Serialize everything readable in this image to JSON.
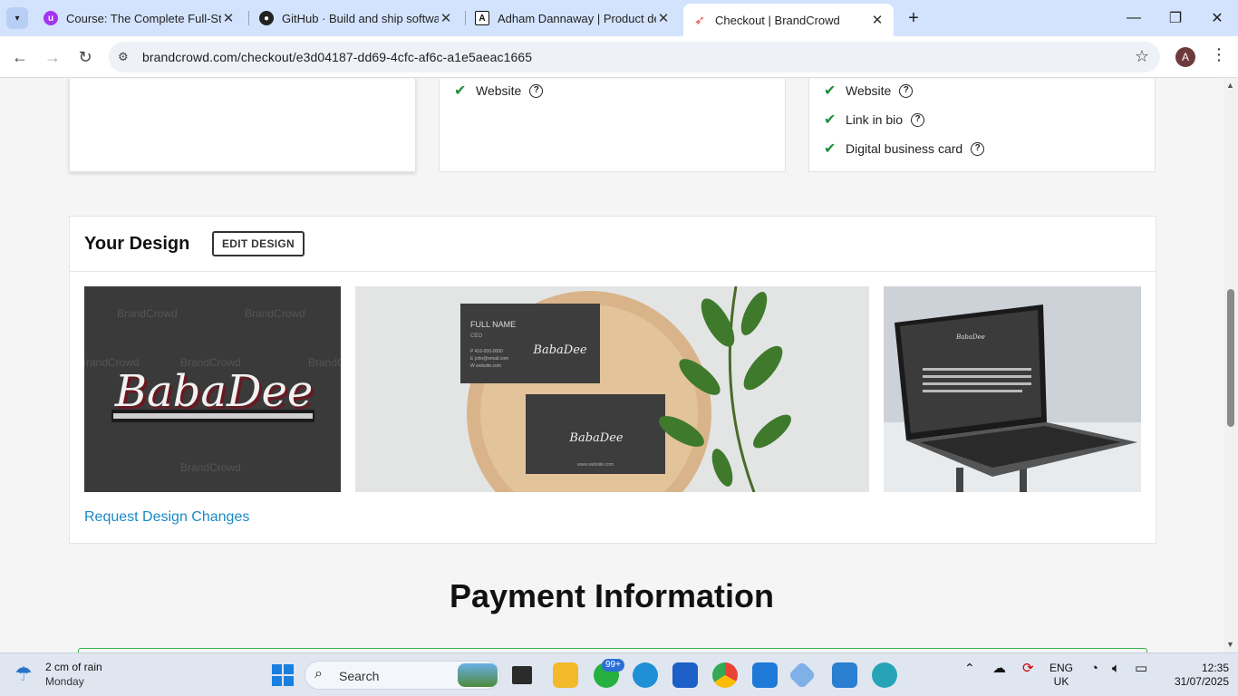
{
  "browser": {
    "tabs": [
      {
        "title": "Course: The Complete Full-Stack",
        "active": false
      },
      {
        "title": "GitHub · Build and ship software",
        "active": false
      },
      {
        "title": "Adham Dannaway | Product desi",
        "active": false
      },
      {
        "title": "Checkout | BrandCrowd",
        "active": true
      }
    ],
    "url": "brandcrowd.com/checkout/e3d04187-dd69-4cfc-af6c-a1e5aeac1665",
    "profile_initial": "A"
  },
  "plans": {
    "middle_features": [
      "Website"
    ],
    "right_features": [
      "Website",
      "Link in bio",
      "Digital business card"
    ]
  },
  "design": {
    "title": "Your Design",
    "edit_label": "EDIT DESIGN",
    "request_changes": "Request Design Changes",
    "logo_text": "BabaDee",
    "watermark": "BrandCrowd",
    "card_name": "FULL NAME",
    "card_role": "CEO",
    "card_details": [
      "P 416-000-0000",
      "E john@email.com",
      "W website.com"
    ],
    "card_website": "www.website.com"
  },
  "payment": {
    "heading": "Payment Information"
  },
  "taskbar": {
    "weather_line1": "2 cm of rain",
    "weather_line2": "Monday",
    "search_placeholder": "Search",
    "notification_badge": "99+",
    "lang_line1": "ENG",
    "lang_line2": "UK",
    "time": "12:35",
    "date": "31/07/2025"
  }
}
